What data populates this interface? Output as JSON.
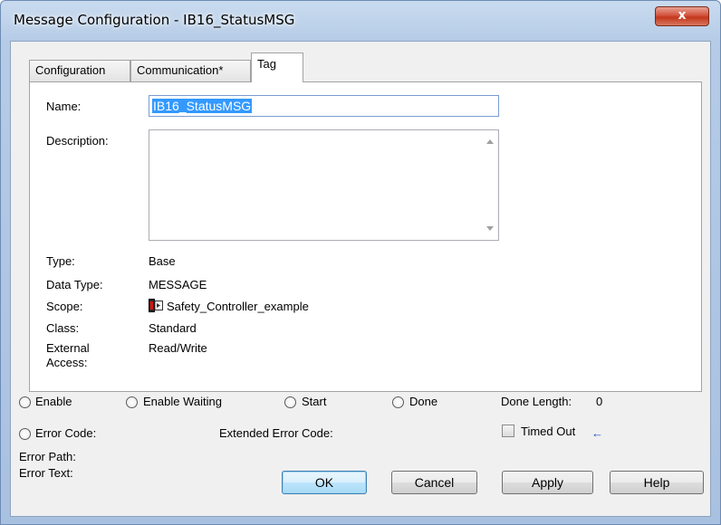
{
  "window": {
    "title": "Message Configuration - IB16_StatusMSG",
    "close_label": "x"
  },
  "tabs": [
    {
      "label": "Configuration",
      "active": false
    },
    {
      "label": "Communication*",
      "active": false
    },
    {
      "label": "Tag",
      "active": true
    }
  ],
  "tag_panel": {
    "name_label": "Name:",
    "name_value": "IB16_StatusMSG",
    "description_label": "Description:",
    "description_value": "",
    "type_label": "Type:",
    "type_value": "Base",
    "data_type_label": "Data Type:",
    "data_type_value": "MESSAGE",
    "scope_label": "Scope:",
    "scope_value": "Safety_Controller_example",
    "scope_icon": "controller-icon",
    "class_label": "Class:",
    "class_value": "Standard",
    "external_access_label_1": "External",
    "external_access_label_2": "Access:",
    "external_access_value": "Read/Write"
  },
  "status": {
    "enable": "Enable",
    "enable_waiting": "Enable Waiting",
    "start": "Start",
    "done": "Done",
    "done_length_label": "Done Length:",
    "done_length_value": "0",
    "error_code": "Error Code:",
    "extended_error_code": "Extended Error Code:",
    "timed_out": "Timed Out",
    "timed_out_arrow": "←",
    "error_path": "Error Path:",
    "error_text": "Error Text:"
  },
  "buttons": {
    "ok": "OK",
    "cancel": "Cancel",
    "apply": "Apply",
    "help": "Help"
  }
}
